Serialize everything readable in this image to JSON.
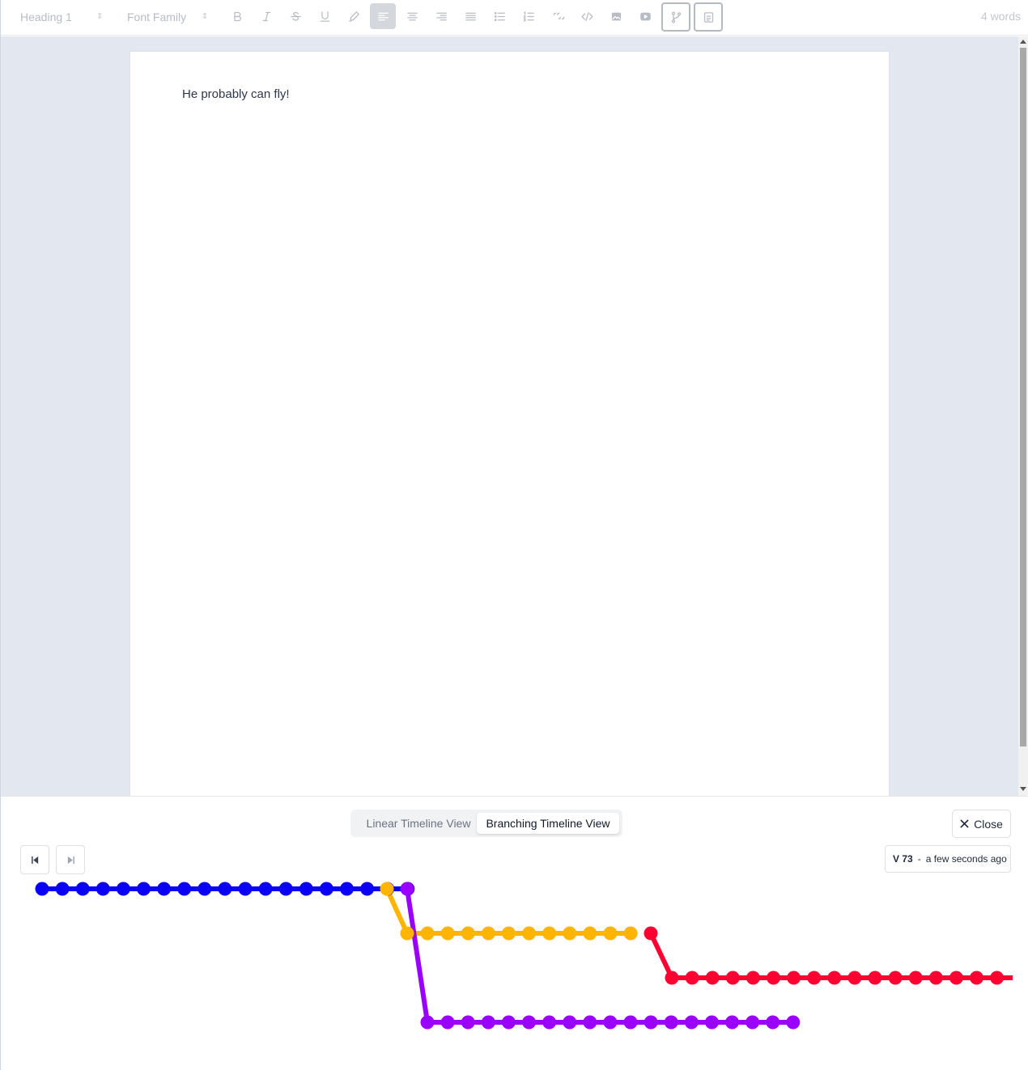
{
  "toolbar": {
    "heading_select": "Heading 1",
    "font_select": "Font Family",
    "word_count": "4 words",
    "buttons": [
      "bold",
      "italic",
      "strikethrough",
      "underline",
      "highlight",
      "align-left",
      "align-center",
      "align-right",
      "align-justify",
      "bullet-list",
      "ordered-list",
      "blockquote",
      "code",
      "image",
      "video",
      "branch",
      "history"
    ]
  },
  "document": {
    "text": "He probably can fly!"
  },
  "history_panel": {
    "tabs": [
      "Linear Timeline View",
      "Branching Timeline View"
    ],
    "active_tab": "Branching Timeline View",
    "close_label": "Close",
    "version_label": "V 73",
    "version_separator": "-",
    "version_time": "a few seconds ago",
    "branches": [
      {
        "color": "#0a00f5",
        "nodes": 19
      },
      {
        "color": "#ffb400",
        "nodes": 13
      },
      {
        "color": "#ff0033",
        "nodes": 18
      },
      {
        "color": "#9900ff",
        "nodes": 20
      }
    ]
  }
}
